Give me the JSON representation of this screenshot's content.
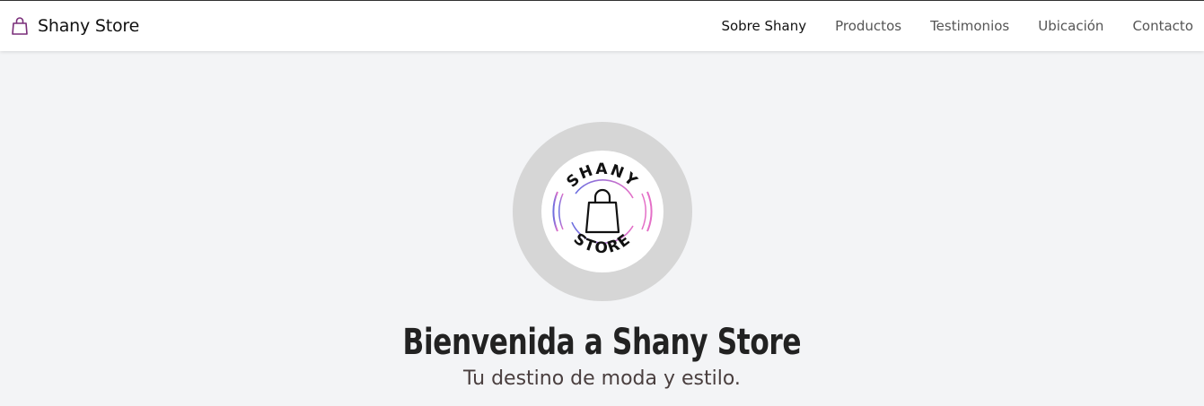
{
  "navbar": {
    "brand": {
      "icon": "shopping-bag-icon",
      "text": "Shany Store",
      "icon_color": "#7a2e7a"
    },
    "links": [
      {
        "label": "Sobre Shany",
        "active": true
      },
      {
        "label": "Productos",
        "active": false
      },
      {
        "label": "Testimonios",
        "active": false
      },
      {
        "label": "Ubicación",
        "active": false
      },
      {
        "label": "Contacto",
        "active": false
      }
    ]
  },
  "hero": {
    "logo": {
      "top_text": "SHANY",
      "bottom_text": "STORE",
      "icon": "shopping-bag-icon",
      "gradient_start": "#6b6fe0",
      "gradient_end": "#e46fc7"
    },
    "title": "Bienvenida a Shany Store",
    "subtitle": "Tu destino de moda y estilo."
  },
  "colors": {
    "background": "#f3f4f6",
    "navbar": "#ffffff",
    "logo_circle": "#d6d6d6"
  }
}
